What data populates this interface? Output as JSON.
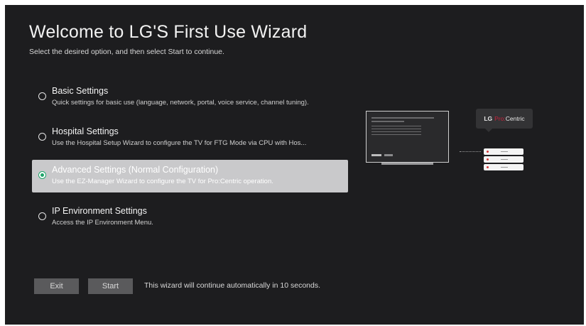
{
  "wizard": {
    "title": "Welcome to LG'S First Use Wizard",
    "subtitle": "Select the desired option, and then select Start to continue."
  },
  "options": [
    {
      "title": "Basic Settings",
      "description": "Quick settings for basic use (language, network, portal, voice service, channel tuning).",
      "selected": false
    },
    {
      "title": "Hospital Settings",
      "description": "Use the Hospital Setup Wizard to configure the TV for FTG Mode via CPU with Hos...",
      "selected": false
    },
    {
      "title": "Advanced Settings (Normal Configuration)",
      "description": "Use the EZ-Manager Wizard to configure the TV for Pro:Centric operation.",
      "selected": true
    },
    {
      "title": "IP Environment Settings",
      "description": "Access the IP Environment Menu.",
      "selected": false
    }
  ],
  "footer": {
    "exit_label": "Exit",
    "start_label": "Start",
    "countdown_text": "This wizard will continue automatically in 10 seconds."
  },
  "illustration": {
    "logo_lg": "LG",
    "logo_pro": "Pro:",
    "logo_centric": "Centric"
  },
  "colors": {
    "background": "#1d1d1f",
    "selected_row": "#c9c9cb",
    "selected_radio": "#1fa46a",
    "button": "#5a5a5c",
    "logo_accent": "#c8223b"
  },
  "icons": {
    "radio_unselected": "radio-empty-icon",
    "radio_selected": "radio-selected-icon",
    "tv": "tv-illustration-icon",
    "server": "server-stack-icon"
  }
}
